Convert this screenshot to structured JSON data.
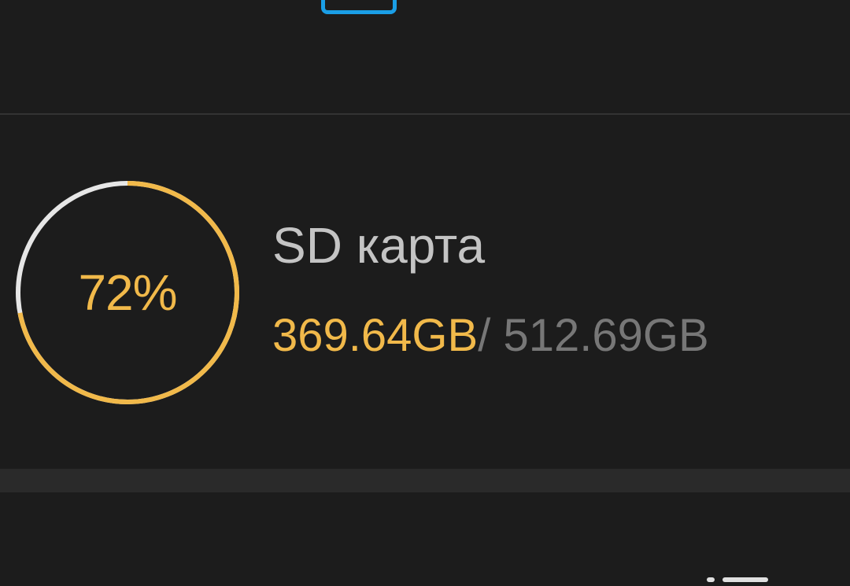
{
  "colors": {
    "background": "#1c1c1c",
    "accent": "#f1b94a",
    "ring_track": "#e6e6e6",
    "top_icon": "#1a9ee6",
    "title": "#c4c4c4",
    "secondary": "#777777"
  },
  "storage": {
    "percent_label": "72%",
    "used_fraction": 0.72,
    "title": "SD карта",
    "used": "369.64GB",
    "separator": "/",
    "total": " 512.69GB"
  }
}
